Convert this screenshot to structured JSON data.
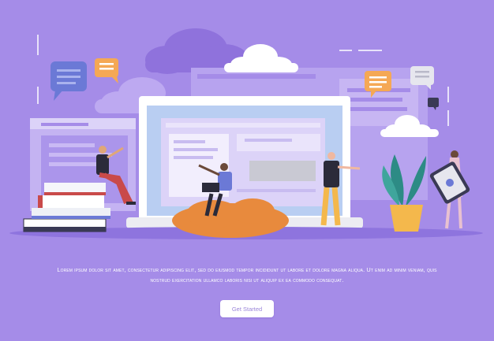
{
  "body_text": "Lorem ipsum dolor sit amet, consectetur adipiscing elit, sed do eiusmod tempor incididunt ut labore et dolore magna aliqua. Ut enim ad minim veniam, quis nostrud exercitation ullamco laboris nisi ut aliquip ex ea commodo consequat.",
  "cta_label": "Get Started",
  "colors": {
    "background": "#a58ce8",
    "window_back": "#b7a3ef",
    "window_front": "#dcd3f8",
    "cloud_dark": "#8f72dc",
    "cloud_light": "#ffffff",
    "bubble_orange": "#f5a855",
    "bubble_blue": "#6b79d6",
    "bubble_gray": "#e6e6ee",
    "mound": "#e88a3d",
    "plant": "#2d8b85",
    "pot": "#f4b84c",
    "button_text": "#9b86d9"
  },
  "icons": [
    "chat-bubble-icon",
    "cloud-icon",
    "laptop-icon",
    "tablet-icon",
    "plant-icon",
    "books-icon"
  ]
}
